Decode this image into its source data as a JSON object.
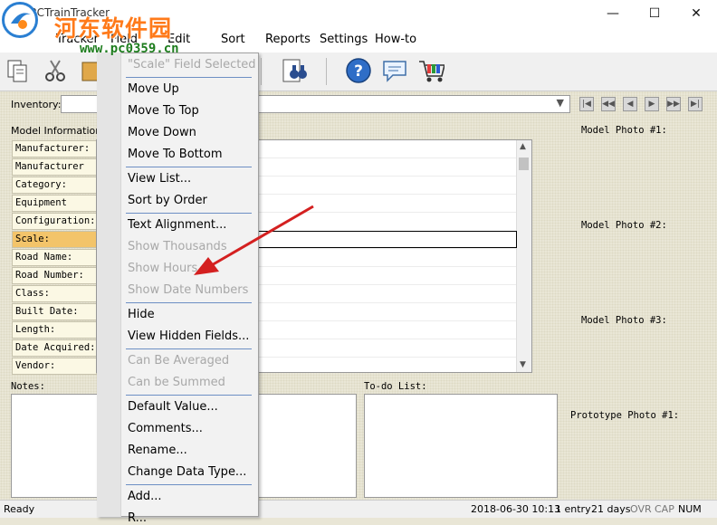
{
  "window": {
    "title": "FRCTrainTracker",
    "minimize": "—",
    "maximize": "☐",
    "close": "✕"
  },
  "menu": [
    "Tracker",
    "Field",
    "Edit",
    "Sort",
    "Reports",
    "Settings",
    "How-to"
  ],
  "toolbar": {
    "icons": [
      "copy-icon",
      "scissors-icon",
      "paste-icon",
      "binoculars-icon",
      "help-icon",
      "speech-bubble-icon",
      "shopping-cart-icon"
    ]
  },
  "inventory": {
    "label": "Inventory:",
    "value": ""
  },
  "model_info": {
    "label": "Model Information:",
    "fields": [
      "Manufacturer:",
      "Manufacturer ID",
      "Category:",
      "Equipment Type:",
      "Configuration:",
      "Scale:",
      "Road Name:",
      "Road Number:",
      "Class:",
      "Built Date:",
      "Length:",
      "Date Acquired:",
      "Vendor:"
    ],
    "selected": "Scale:"
  },
  "photos": [
    "Model Photo #1:",
    "Model Photo #2:",
    "Model Photo #3:",
    "Prototype Photo #1:"
  ],
  "notes_label": "Notes:",
  "todo_label": "To-do List:",
  "status": {
    "ready": "Ready",
    "datetime": "2018-06-30 10:13",
    "entries": "1 entry",
    "days": "21 days",
    "ovr": "OVR",
    "cap": "CAP",
    "num": "NUM"
  },
  "context_menu": {
    "header": "\"Scale\" Field Selected",
    "items": [
      "Move Up",
      "Move To Top",
      "Move Down",
      "Move To Bottom",
      "View List...",
      "Sort by Order",
      "Text Alignment...",
      "Show Thousands",
      "Show Hours",
      "Show Date Numbers",
      "Hide",
      "View Hidden Fields...",
      "Can Be Averaged",
      "Can be Summed",
      "Default Value...",
      "Comments...",
      "Rename...",
      "Change Data Type...",
      "Add...",
      "R..."
    ]
  },
  "watermark": {
    "title": "河东软件园",
    "url": "www.pc0359.cn"
  },
  "colors": {
    "panel": "#e9e6d6",
    "field": "#fbf8e4",
    "field_selected": "#f3c46a",
    "arrow": "#d42020",
    "watermark_orange": "#ff7a1a"
  }
}
